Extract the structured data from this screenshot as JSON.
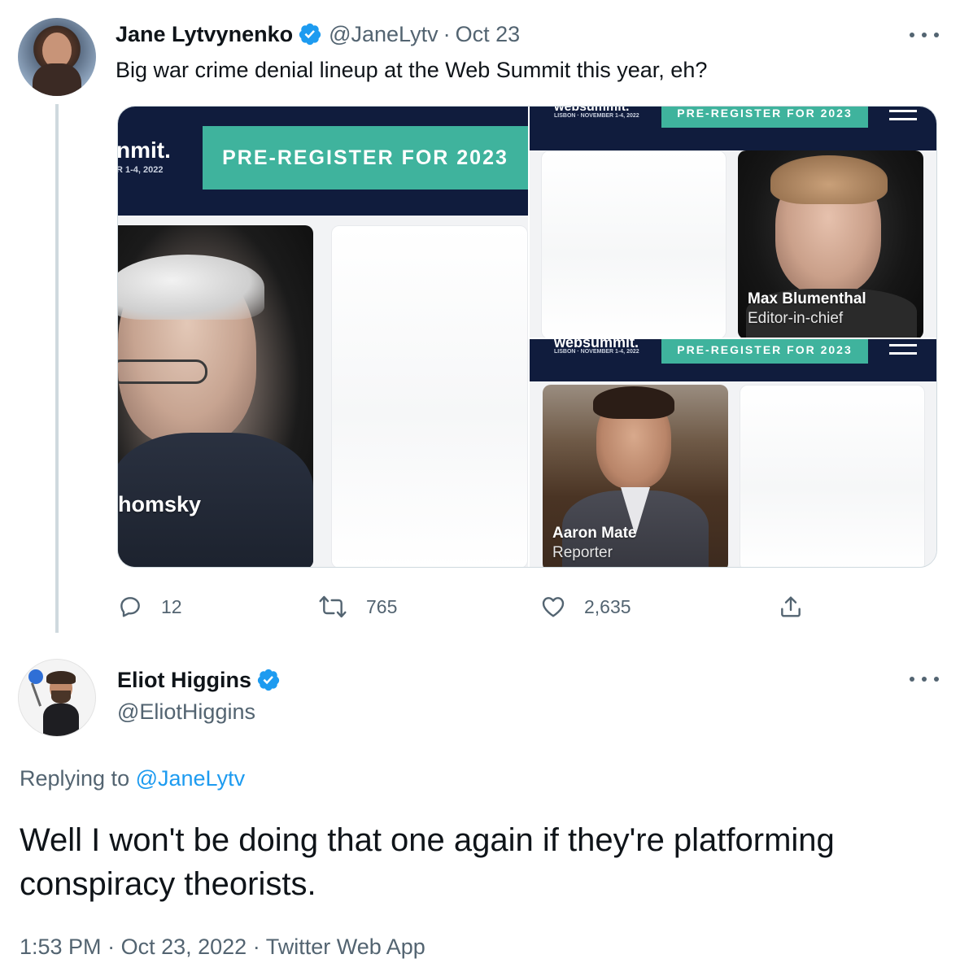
{
  "tweet1": {
    "display_name": "Jane Lytvynenko",
    "handle": "@JaneLytv",
    "separator": "·",
    "date": "Oct 23",
    "text": "Big war crime denial lineup at the Web Summit this year, eh?",
    "media": {
      "left_logo": "nmit.",
      "left_sub": "R 1-4, 2022",
      "cta": "PRE-REGISTER FOR 2023",
      "left_caption": "homsky",
      "logo": "websummit.",
      "logo_sub": "LISBON · NOVEMBER 1-4, 2022",
      "tr_caption_name": "Max Blumenthal",
      "tr_caption_role": "Editor-in-chief",
      "br_caption_name": "Aaron Mate",
      "br_caption_role": "Reporter"
    },
    "actions": {
      "replies": "12",
      "retweets": "765",
      "likes": "2,635"
    },
    "colors": {
      "verified": "#1d9bf0",
      "websummit_navy": "#101c3d",
      "websummit_teal": "#3fb39d"
    }
  },
  "tweet2": {
    "display_name": "Eliot Higgins",
    "handle": "@EliotHiggins",
    "replying_prefix": "Replying to ",
    "replying_to": "@JaneLytv",
    "text": "Well I won't be doing that one again if they're platforming conspiracy theorists.",
    "time": "1:53 PM",
    "separator": "·",
    "date": "Oct 23, 2022",
    "source": "Twitter Web App"
  },
  "icons": [
    "verified-badge-icon",
    "more-options-icon",
    "reply-icon",
    "retweet-icon",
    "like-icon",
    "share-icon"
  ]
}
